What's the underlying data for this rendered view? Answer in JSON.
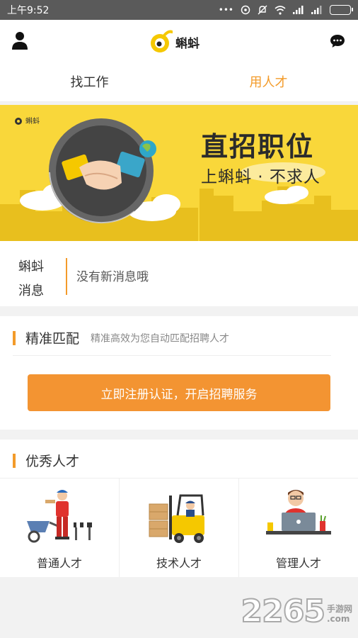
{
  "status_bar": {
    "time": "上午9:52",
    "dots": "•••"
  },
  "header": {
    "app_name": "蝌蚪",
    "user_icon": "user-icon",
    "chat_icon": "chat-bubble-icon"
  },
  "tabs": [
    {
      "label": "找工作",
      "active": false
    },
    {
      "label": "用人才",
      "active": true
    }
  ],
  "banner": {
    "logo_text": "蝌蚪",
    "title": "直招职位",
    "subtitle": "上蝌蚪 · 不求人"
  },
  "messages": {
    "label_line1": "蝌蚪",
    "label_line2": "消息",
    "text": "没有新消息哦"
  },
  "match": {
    "title": "精准匹配",
    "description": "精准高效为您自动匹配招聘人才",
    "cta_label": "立即注册认证，开启招聘服务"
  },
  "talent": {
    "title": "优秀人才",
    "items": [
      {
        "label": "普通人才",
        "icon": "worker-icon"
      },
      {
        "label": "技术人才",
        "icon": "forklift-icon"
      },
      {
        "label": "管理人才",
        "icon": "manager-icon"
      }
    ]
  },
  "watermark": {
    "number": "2265",
    "line1": "手游网",
    "line2": ".com"
  },
  "colors": {
    "accent": "#f39b2a",
    "banner_bg": "#f9d73a",
    "status_bar": "#5a5a5a"
  }
}
